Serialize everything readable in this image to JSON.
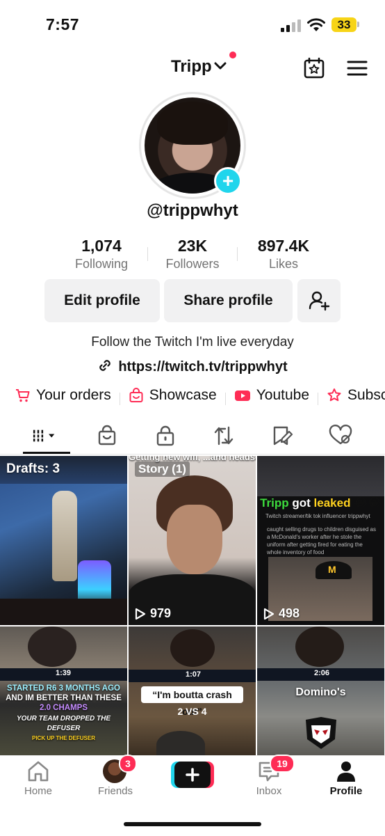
{
  "status_bar": {
    "time": "7:57",
    "battery": "33"
  },
  "header": {
    "username": "Tripp"
  },
  "profile": {
    "handle": "@trippwhyt",
    "stats": [
      {
        "value": "1,074",
        "label": "Following"
      },
      {
        "value": "23K",
        "label": "Followers"
      },
      {
        "value": "897.4K",
        "label": "Likes"
      }
    ],
    "buttons": {
      "edit": "Edit profile",
      "share": "Share profile"
    },
    "bio": "Follow the Twitch I'm live everyday",
    "link": "https://twitch.tv/trippwhyt"
  },
  "shortcuts": [
    {
      "label": "Your orders",
      "icon": "cart-icon"
    },
    {
      "label": "Showcase",
      "icon": "shop-bag-icon"
    },
    {
      "label": "Youtube",
      "icon": "youtube-icon"
    },
    {
      "label": "Subscr",
      "icon": "subscription-icon"
    }
  ],
  "tabs": [
    "videos-grid-icon",
    "shop-icon",
    "private-lock-icon",
    "repost-icon",
    "favorites-icon",
    "liked-icon"
  ],
  "grid": {
    "drafts_label": "Drafts: 3",
    "story_label": "Story (1)",
    "story_caption": "Getting new wifi, ...and headset",
    "tile2_views": "979",
    "tile3_views": "498",
    "tile3": {
      "headline_a": "Tripp",
      "headline_b": "got",
      "headline_c": "leaked",
      "subtitle": "Twitch streamer/tik tok influencer trippwhyt",
      "body": "caught selling drugs to children disguised as a McDonald's worker after he stole the uniform after getting fired for eating the whole inventory of food"
    },
    "tile4": {
      "hud_score": "1:39",
      "line1": "STARTED R6 3 MONTHS AGO",
      "line2": "AND IM BETTER THAN THESE",
      "line3": "2.0 CHAMPS",
      "line4": "YOUR TEAM DROPPED THE DEFUSER",
      "line5": "PICK UP THE DEFUSER"
    },
    "tile5": {
      "hud_score": "1:07",
      "quote": "“I'm boutta crash out”",
      "score": "2 VS 4"
    },
    "tile6": {
      "hud_score": "2:06",
      "caption": "Domino's"
    }
  },
  "nav": {
    "home": "Home",
    "friends": "Friends",
    "friends_badge": "3",
    "inbox": "Inbox",
    "inbox_badge": "19",
    "profile": "Profile"
  },
  "colors": {
    "accent_red": "#fe2c55",
    "accent_cyan": "#20d5ec",
    "battery": "#f7d417"
  }
}
